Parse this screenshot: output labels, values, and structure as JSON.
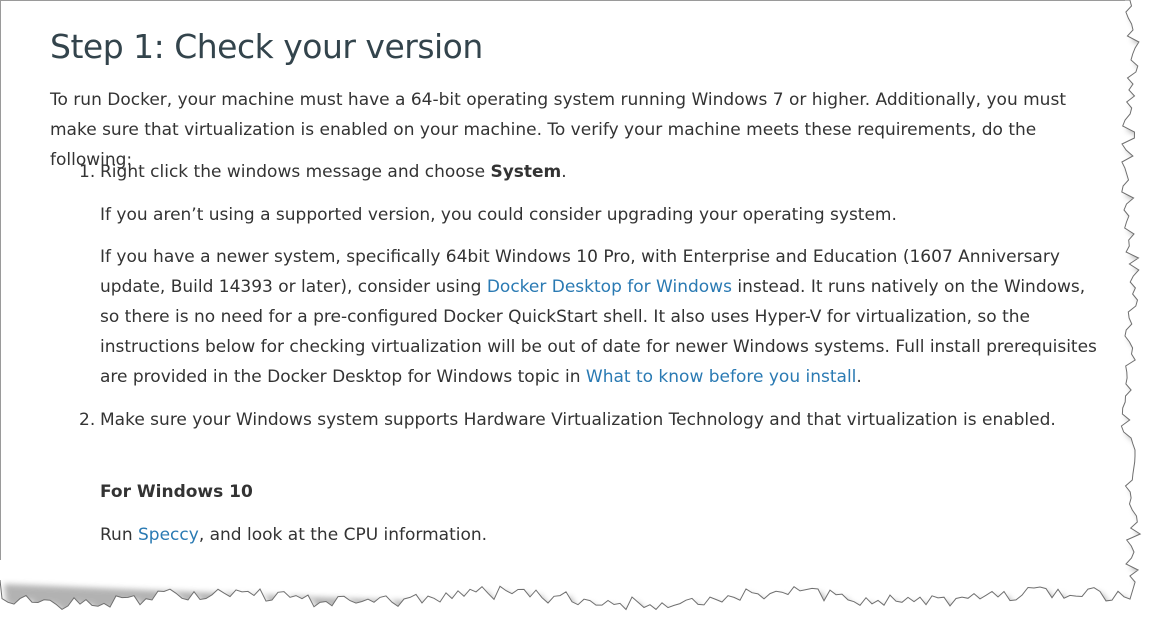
{
  "page": {
    "title": "Step 1: Check your version",
    "intro": "To run Docker, your machine must have a 64-bit operating system running Windows 7 or higher. Additionally, you must make sure that virtualization is enabled on your machine. To verify your machine meets these requirements, do the following:",
    "steps": [
      {
        "number": "1.",
        "text_before": "Right click the windows message and choose ",
        "bold": "System",
        "text_after": ".",
        "sub1": "If you aren’t using a supported version, you could consider upgrading your operating system.",
        "sub2_before": "If you have a newer system, specifically 64bit Windows 10 Pro, with Enterprise and Education (1607 Anniversary update, Build 14393 or later), consider using ",
        "sub2_link": "Docker Desktop for Windows",
        "sub2_middle": " instead. It runs natively on the Windows, so there is no need for a pre-configured Docker QuickStart shell. It also uses Hyper-V for virtualization, so the instructions below for checking virtualization will be out of date for newer Windows systems. Full install prerequisites are provided in the Docker Desktop for Windows topic in ",
        "sub2_link2": "What to know before you install",
        "sub2_after": "."
      },
      {
        "number": "2.",
        "text": "Make sure your Windows system supports Hardware Virtualization Technology and that virtualization is enabled.",
        "heading": "For Windows 10",
        "run_before": "Run ",
        "run_link": "Speccy",
        "run_after": ", and look at the CPU information."
      }
    ]
  }
}
